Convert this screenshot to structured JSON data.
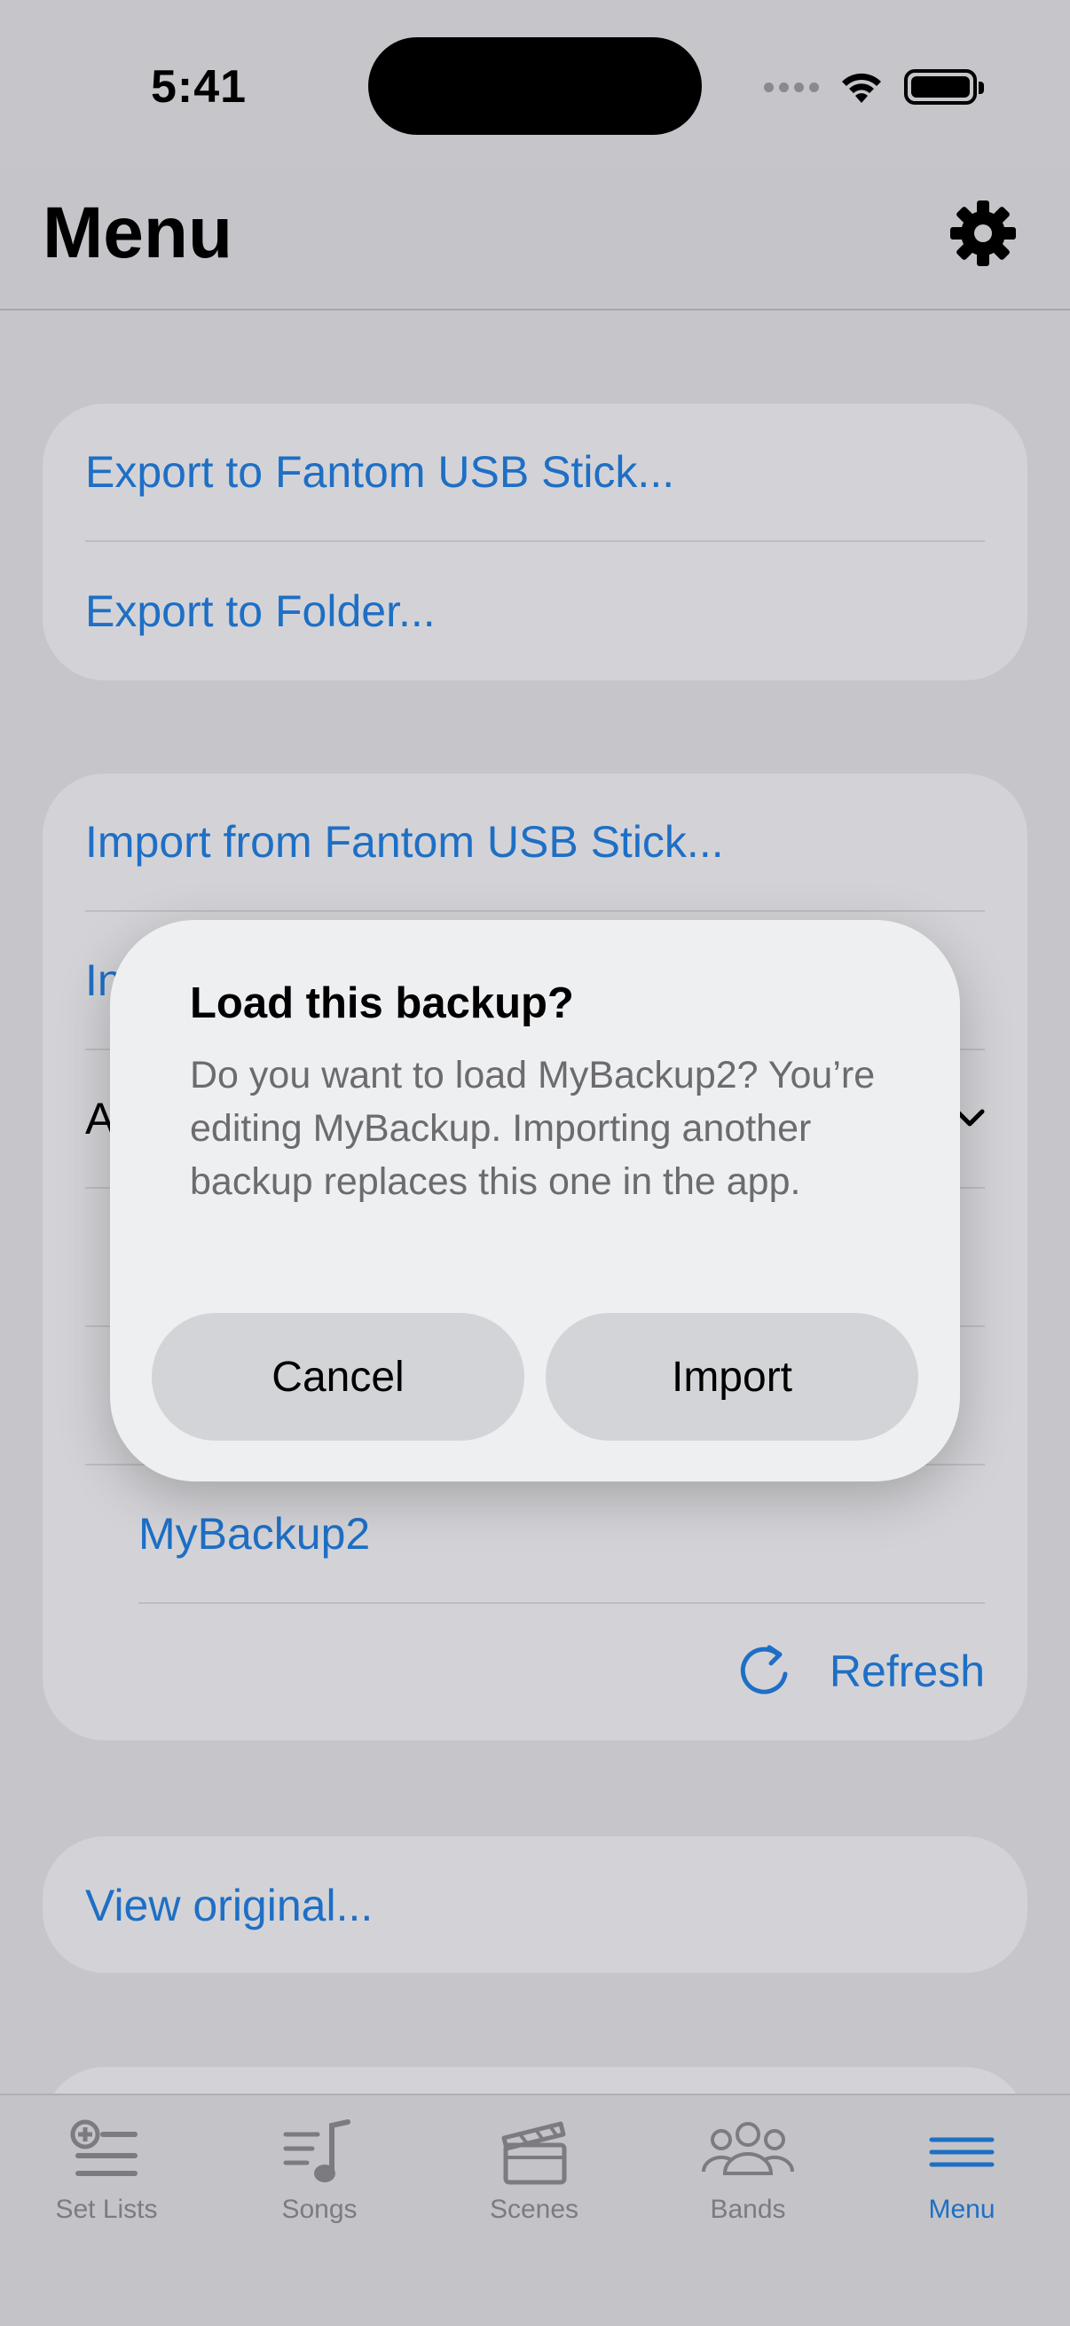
{
  "status_bar": {
    "time": "5:41"
  },
  "nav": {
    "title": "Menu"
  },
  "export_section": {
    "items": [
      "Export to Fantom USB Stick...",
      "Export to Folder..."
    ]
  },
  "import_section": {
    "items": [
      "Import from Fantom USB Stick...",
      "In",
      "A"
    ],
    "backup_item": "MyBackup2",
    "refresh_label": "Refresh"
  },
  "view_section": {
    "label": "View original..."
  },
  "dialog": {
    "title": "Load this backup?",
    "message": "Do you want to load MyBackup2? You’re editing MyBackup. Importing another backup replaces this one in the app.",
    "cancel_label": "Cancel",
    "import_label": "Import"
  },
  "tab_bar": {
    "tabs": [
      {
        "label": "Set Lists",
        "icon": "set-lists-icon"
      },
      {
        "label": "Songs",
        "icon": "songs-icon"
      },
      {
        "label": "Scenes",
        "icon": "scenes-icon"
      },
      {
        "label": "Bands",
        "icon": "bands-icon"
      },
      {
        "label": "Menu",
        "icon": "menu-icon"
      }
    ],
    "active": "Menu"
  },
  "colors": {
    "accent": "#1e6fc5",
    "background": "#c6c6ca",
    "card": "#d3d3d7",
    "dialog": "#eeeff1"
  }
}
